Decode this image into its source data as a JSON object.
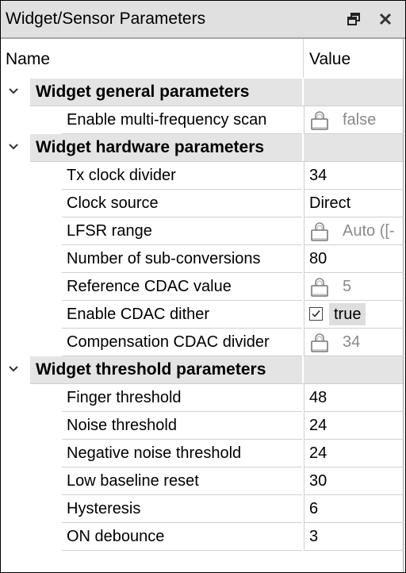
{
  "window": {
    "title": "Widget/Sensor Parameters",
    "buttons": [
      {
        "name": "restore",
        "icon": "float-window-icon"
      },
      {
        "name": "close",
        "icon": "close-icon"
      }
    ]
  },
  "columns": {
    "name": "Name",
    "value": "Value"
  },
  "groups": [
    {
      "label": "Widget general parameters",
      "expanded": true,
      "items": [
        {
          "name": "Enable multi-frequency scan",
          "value": "false",
          "locked": true
        }
      ]
    },
    {
      "label": "Widget hardware parameters",
      "expanded": true,
      "items": [
        {
          "name": "Tx clock divider",
          "value": "34",
          "locked": false
        },
        {
          "name": "Clock source",
          "value": "Direct",
          "locked": false
        },
        {
          "name": "LFSR range",
          "value": "Auto ([-",
          "locked": true
        },
        {
          "name": "Number of sub-conversions",
          "value": "80",
          "locked": false
        },
        {
          "name": "Reference CDAC value",
          "value": "5",
          "locked": true
        },
        {
          "name": "Enable CDAC dither",
          "value": "true",
          "locked": false,
          "checkbox": true,
          "checked": true
        },
        {
          "name": "Compensation CDAC divider",
          "value": "34",
          "locked": true
        }
      ]
    },
    {
      "label": "Widget threshold parameters",
      "expanded": true,
      "items": [
        {
          "name": "Finger threshold",
          "value": "48",
          "locked": false
        },
        {
          "name": "Noise threshold",
          "value": "24",
          "locked": false
        },
        {
          "name": "Negative noise threshold",
          "value": "24",
          "locked": false
        },
        {
          "name": "Low baseline reset",
          "value": "30",
          "locked": false
        },
        {
          "name": "Hysteresis",
          "value": "6",
          "locked": false
        },
        {
          "name": "ON debounce",
          "value": "3",
          "locked": false
        }
      ]
    }
  ]
}
